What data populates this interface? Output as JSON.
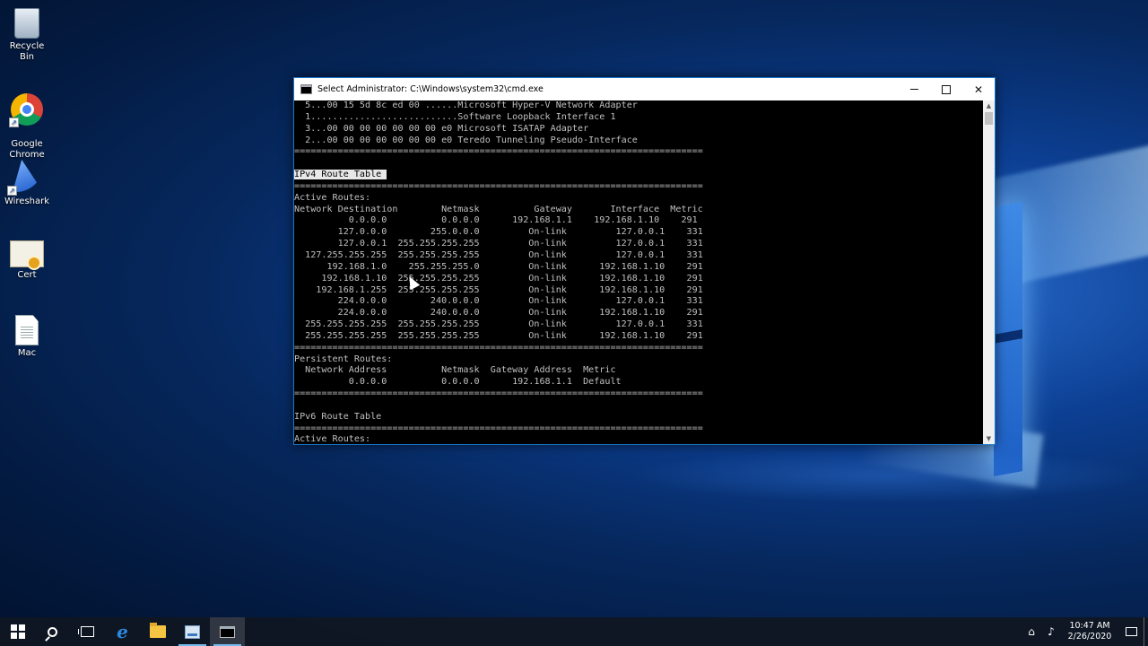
{
  "desktop": {
    "icons": [
      {
        "label": "Recycle Bin",
        "icon": "recycle-bin-icon"
      },
      {
        "label": "Google\nChrome",
        "icon": "chrome-icon"
      },
      {
        "label": "Wireshark",
        "icon": "wireshark-icon"
      },
      {
        "label": "Cert",
        "icon": "certificate-icon"
      },
      {
        "label": "Mac",
        "icon": "text-file-icon"
      }
    ]
  },
  "window": {
    "title": "Select Administrator: C:\\Windows\\system32\\cmd.exe",
    "controls": {
      "minimize": "minimize-icon",
      "maximize": "maximize-icon",
      "close": "✕"
    },
    "selected_text": "IPv4 Route Table ",
    "lines": [
      "  5...00 15 5d 8c ed 00 ......Microsoft Hyper-V Network Adapter",
      "  1...........................Software Loopback Interface 1",
      "  3...00 00 00 00 00 00 00 e0 Microsoft ISATAP Adapter",
      "  2...00 00 00 00 00 00 00 e0 Teredo Tunneling Pseudo-Interface",
      "===========================================================================",
      "",
      "",
      "===========================================================================",
      "Active Routes:",
      "Network Destination        Netmask          Gateway       Interface  Metric",
      "          0.0.0.0          0.0.0.0      192.168.1.1    192.168.1.10    291",
      "        127.0.0.0        255.0.0.0         On-link         127.0.0.1    331",
      "        127.0.0.1  255.255.255.255         On-link         127.0.0.1    331",
      "  127.255.255.255  255.255.255.255         On-link         127.0.0.1    331",
      "      192.168.1.0    255.255.255.0         On-link      192.168.1.10    291",
      "     192.168.1.10  255.255.255.255         On-link      192.168.1.10    291",
      "    192.168.1.255  255.255.255.255         On-link      192.168.1.10    291",
      "        224.0.0.0        240.0.0.0         On-link         127.0.0.1    331",
      "        224.0.0.0        240.0.0.0         On-link      192.168.1.10    291",
      "  255.255.255.255  255.255.255.255         On-link         127.0.0.1    331",
      "  255.255.255.255  255.255.255.255         On-link      192.168.1.10    291",
      "===========================================================================",
      "Persistent Routes:",
      "  Network Address          Netmask  Gateway Address  Metric",
      "          0.0.0.0          0.0.0.0      192.168.1.1  Default",
      "===========================================================================",
      "",
      "IPv6 Route Table",
      "===========================================================================",
      "Active Routes:"
    ]
  },
  "taskbar": {
    "apps": [
      {
        "name": "start",
        "icon": "windows-logo-icon"
      },
      {
        "name": "search",
        "icon": "search-icon"
      },
      {
        "name": "task-view",
        "icon": "task-view-icon"
      },
      {
        "name": "internet-explorer",
        "icon": "internet-explorer-icon",
        "glyph": "e"
      },
      {
        "name": "file-explorer",
        "icon": "folder-icon"
      },
      {
        "name": "server-manager",
        "icon": "server-manager-icon"
      },
      {
        "name": "command-prompt",
        "icon": "cmd-icon"
      }
    ],
    "tray": {
      "time": "10:47 AM",
      "date": "2/26/2020",
      "network_icon": "network-icon",
      "volume_icon": "volume-icon",
      "notification_icon": "action-center-icon"
    }
  }
}
